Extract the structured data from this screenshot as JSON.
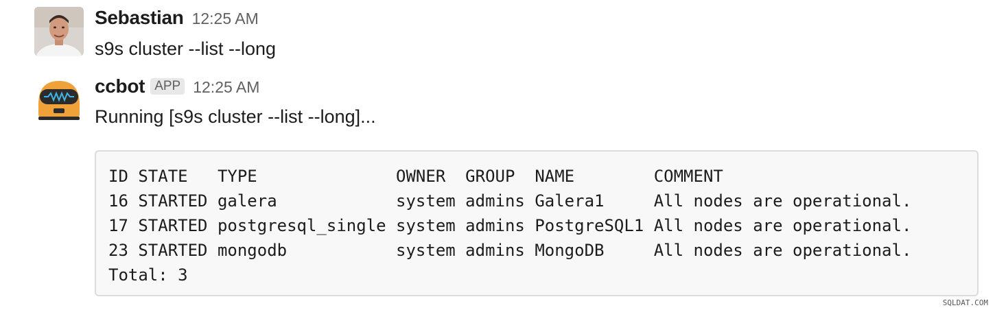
{
  "messages": [
    {
      "author": "Sebastian",
      "time": "12:25 AM",
      "text": "s9s cluster --list --long"
    },
    {
      "author": "ccbot",
      "badge": "APP",
      "time": "12:25 AM",
      "text": "Running [s9s cluster --list --long]...",
      "code": [
        "ID STATE   TYPE              OWNER  GROUP  NAME        COMMENT",
        "16 STARTED galera            system admins Galera1     All nodes are operational.",
        "17 STARTED postgresql_single system admins PostgreSQL1 All nodes are operational.",
        "23 STARTED mongodb           system admins MongoDB     All nodes are operational.",
        "Total: 3"
      ]
    }
  ],
  "watermark": "SQLDAT.COM",
  "colors": {
    "bot_body": "#f0a23a",
    "bot_visor": "#2b2b2b",
    "bot_wave": "#3fb6e8"
  }
}
